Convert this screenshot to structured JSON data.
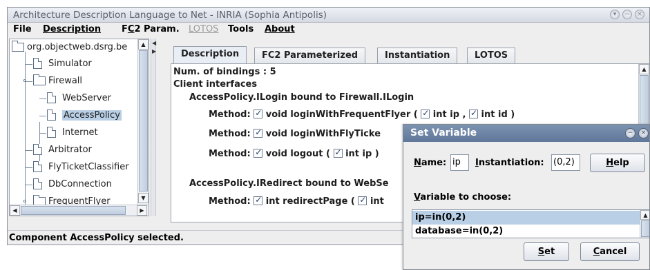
{
  "window": {
    "title": "Architecture Description Language to Net  -  INRIA (Sophia Antipolis)",
    "controls": [
      "chevron-down-icon",
      "minimize-icon",
      "close-icon"
    ]
  },
  "menubar": {
    "file": "File",
    "description": "Description",
    "fc2_prefix": "F",
    "fc2_underlined": "C",
    "fc2_suffix": "2 Param.",
    "lotos": "LOTOS",
    "tools": "Tools",
    "about": "About"
  },
  "tree": {
    "root": "org.objectweb.dsrg.be",
    "simulator": "Simulator",
    "firewall": "Firewall",
    "webserver": "WebServer",
    "accesspolicy": "AccessPolicy",
    "internet": "Internet",
    "arbitrator": "Arbitrator",
    "flyticketclassifier": "FlyTicketClassifier",
    "dbconnection": "DbConnection",
    "frequentflyer": "FrequentFlyer",
    "selected": "AccessPolicy"
  },
  "tabs": {
    "description": "Description",
    "fc2": "FC2 Parameterized",
    "instantiation": "Instantiation",
    "lotos": "LOTOS",
    "active": "Description"
  },
  "content": {
    "bindings": "Num. of bindings :  5",
    "client_interfaces": "Client interfaces",
    "binding1": "AccessPolicy.ILogin bound to Firewall.ILogin",
    "method_label": "Method:",
    "m1_text": "void loginWithFrequentFlyer (",
    "m1_p1": "int ip ,",
    "m1_p2": "int id  )",
    "m2_text": "void loginWithFlyTicke",
    "m3_text": "void logout (",
    "m3_p1": "int ip  )",
    "binding2": "AccessPolicy.IRedirect bound to WebSe",
    "m4_text": "int redirectPage (",
    "m4_p1": "int"
  },
  "status": "Component AccessPolicy selected.",
  "dialog": {
    "title": "Set Variable",
    "name_label_u": "N",
    "name_label_rest": "ame:",
    "name_value": "ip",
    "inst_label_u": "I",
    "inst_label_rest": "nstantiation:",
    "inst_value": "(0,2)",
    "help": "Help",
    "help_u": "H",
    "help_rest": "elp",
    "var_label_u": "V",
    "var_label_rest": "ariable to choose:",
    "variables": [
      "ip=in(0,2)",
      "database=in(0,2)"
    ],
    "selected_variable": "ip=in(0,2)",
    "set_u": "S",
    "set_rest": "et",
    "cancel_u": "C",
    "cancel_rest": "ancel"
  }
}
